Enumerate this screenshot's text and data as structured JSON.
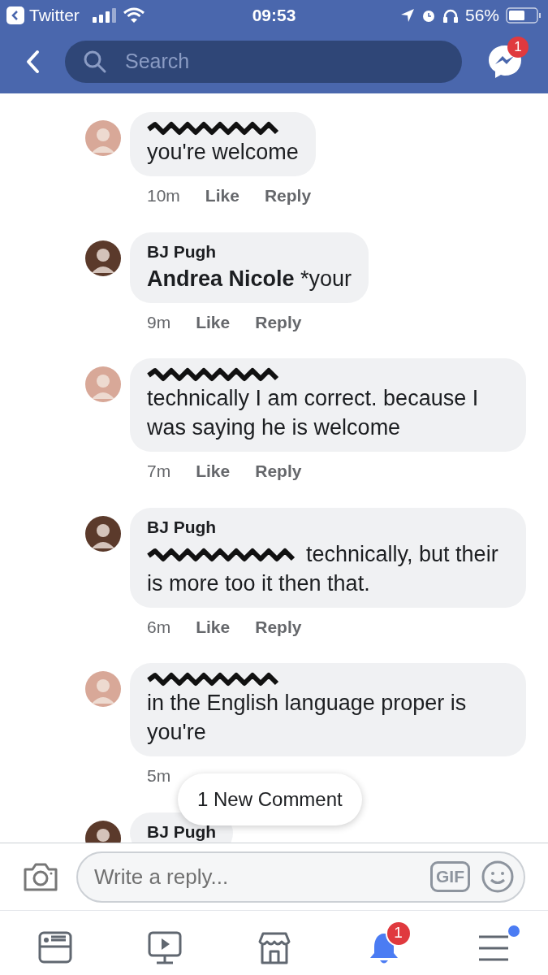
{
  "status_bar": {
    "back_app": "Twitter",
    "time": "09:53",
    "battery": "56%"
  },
  "nav": {
    "search_placeholder": "Search",
    "messenger_badge": "1"
  },
  "comments": [
    {
      "author_redacted": true,
      "color": "#d8a898",
      "text": "you're welcome",
      "time": "10m",
      "like": "Like",
      "reply": "Reply"
    },
    {
      "author": "BJ Pugh",
      "author_redacted": false,
      "color": "#5b3a2b",
      "mention": "Andrea Nicole",
      "text": "*your",
      "time": "9m",
      "like": "Like",
      "reply": "Reply"
    },
    {
      "author_redacted": true,
      "color": "#d8a898",
      "text": "technically I am correct. because I was saying he is welcome",
      "time": "7m",
      "like": "Like",
      "reply": "Reply"
    },
    {
      "author": "BJ Pugh",
      "author_redacted": false,
      "color": "#5b3a2b",
      "mention_redacted": true,
      "text": "technically, but their is more too it then that.",
      "time": "6m",
      "like": "Like",
      "reply": "Reply"
    },
    {
      "author_redacted": true,
      "color": "#d8a898",
      "text": "in the English language proper is you're",
      "time": "5m"
    },
    {
      "author": "BJ Pugh",
      "author_redacted": false,
      "color": "#5b3a2b"
    }
  ],
  "new_comment_pill": "1 New Comment",
  "reply_bar": {
    "placeholder": "Write a reply...",
    "gif": "GIF"
  },
  "tab_bar": [
    {
      "kind": "news",
      "selected": false
    },
    {
      "kind": "video",
      "selected": false
    },
    {
      "kind": "market",
      "selected": false
    },
    {
      "kind": "bell",
      "selected": true,
      "badge": "1"
    },
    {
      "kind": "menu",
      "selected": false,
      "dot": true
    }
  ]
}
